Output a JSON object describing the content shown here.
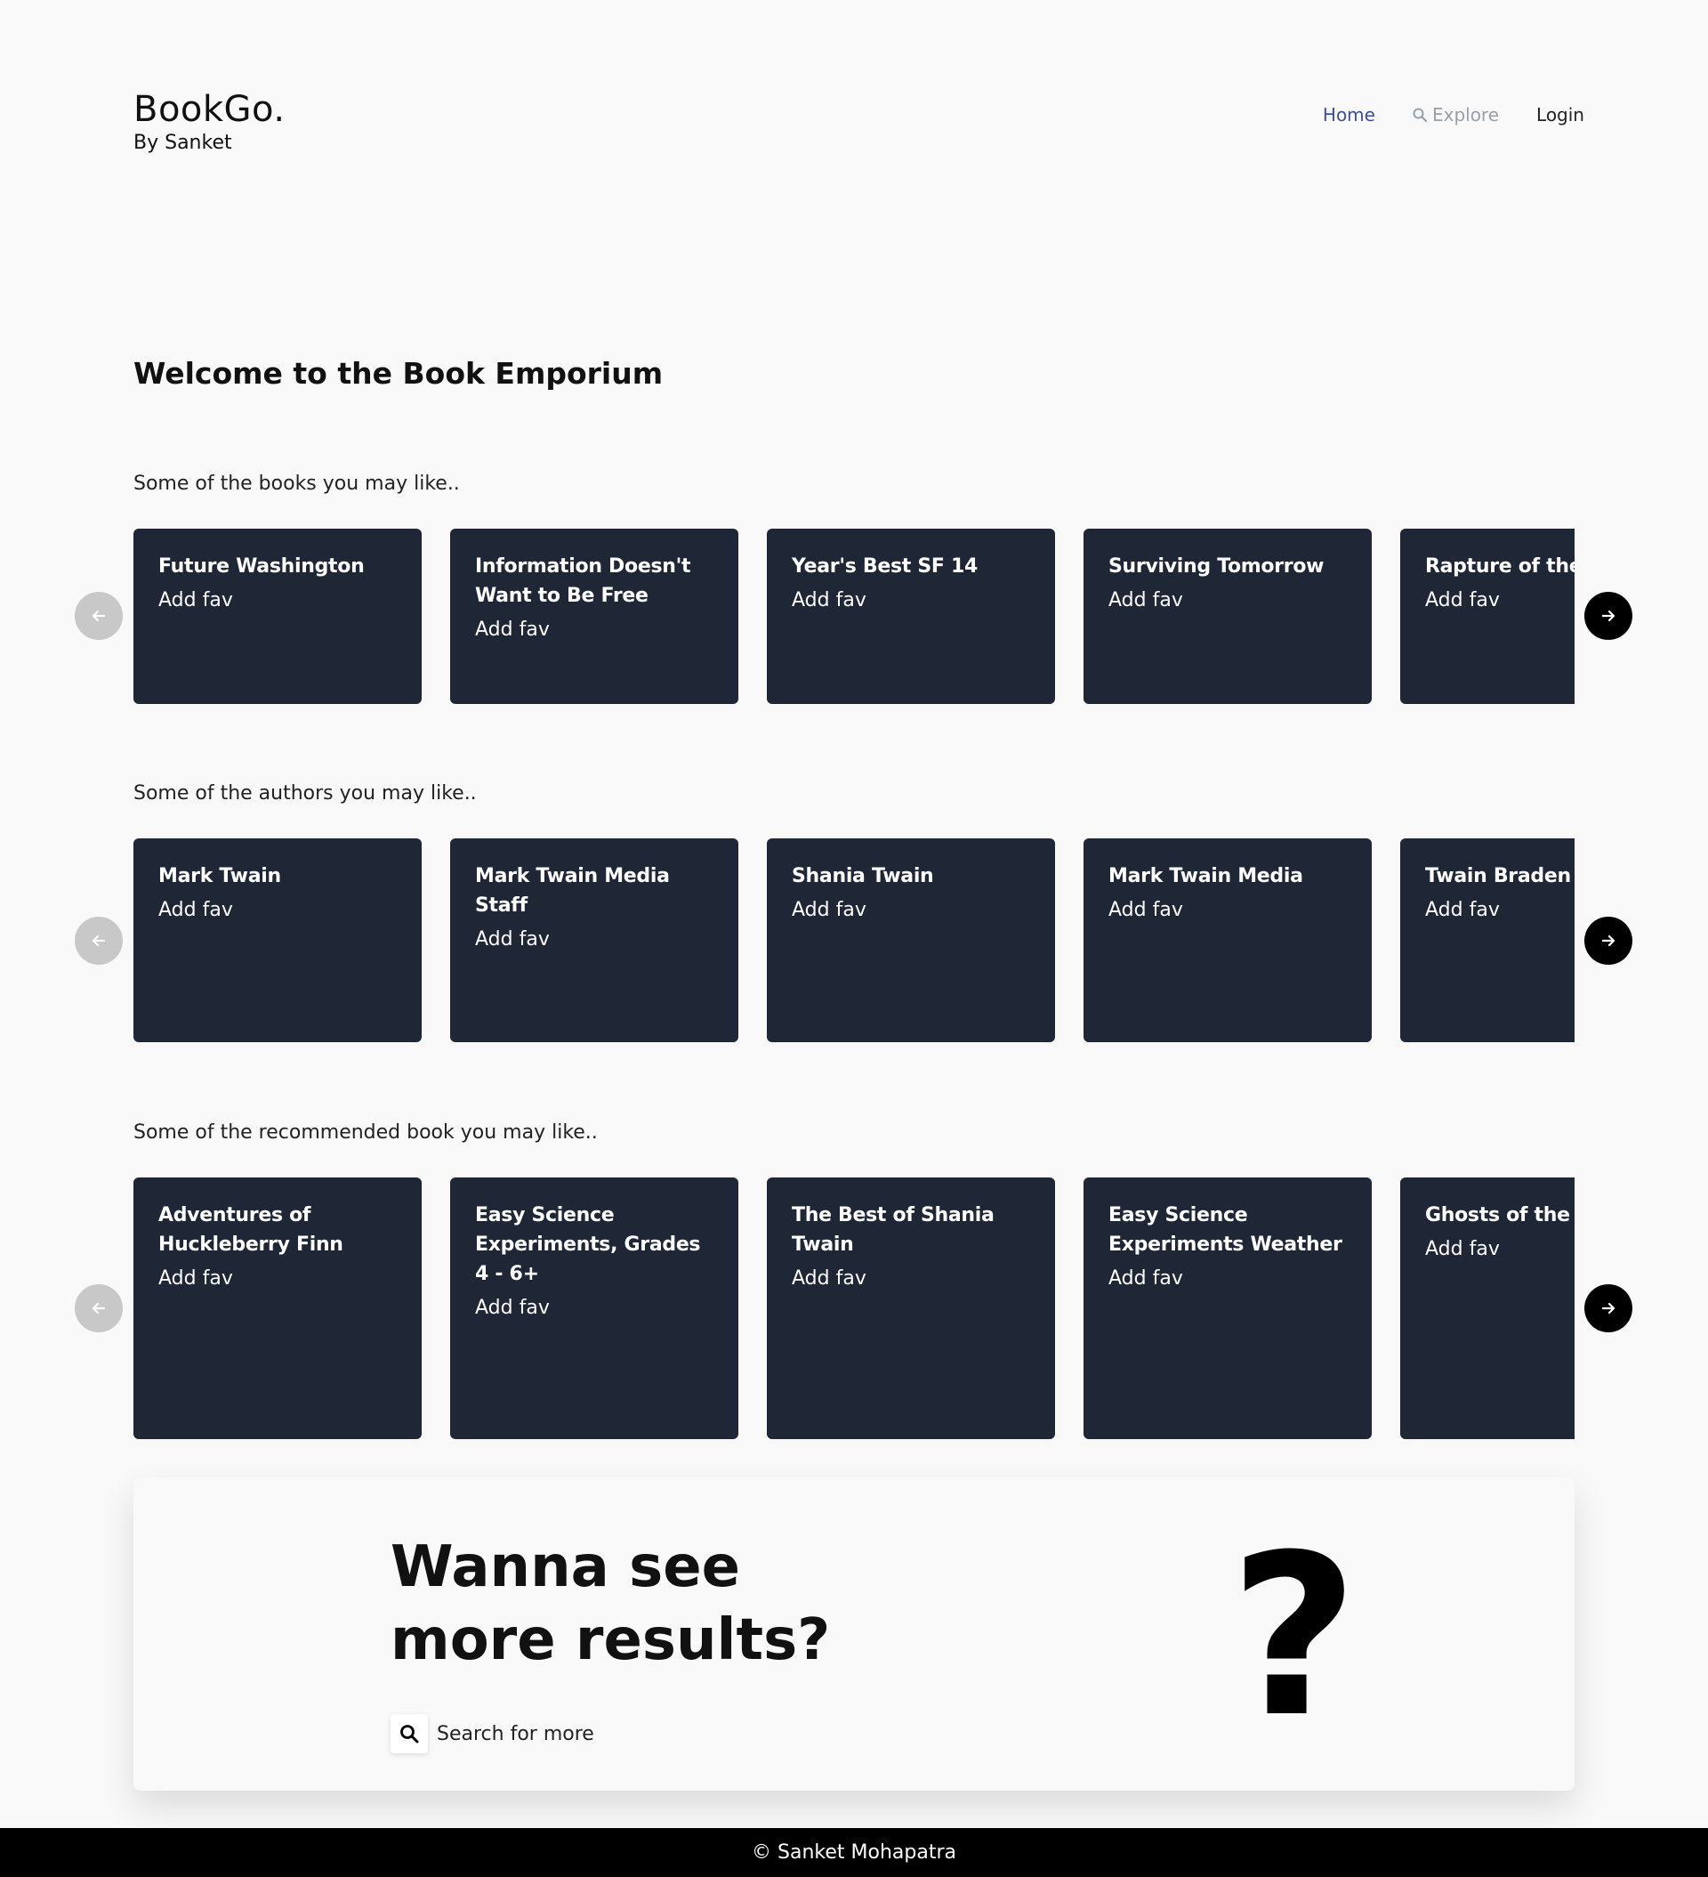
{
  "header": {
    "brand_title": "BookGo.",
    "brand_subtitle": "By Sanket",
    "nav": {
      "home": "Home",
      "explore": "Explore",
      "login": "Login"
    }
  },
  "welcome": {
    "prefix": "Welcome to the",
    "emphasis": "Book Emporium"
  },
  "sections": {
    "books": {
      "label": "Some of the books you may like..",
      "items": [
        {
          "title": "Future Washington",
          "action": "Add fav"
        },
        {
          "title": "Information Doesn't Want to Be Free",
          "action": "Add fav"
        },
        {
          "title": "Year's Best SF 14",
          "action": "Add fav"
        },
        {
          "title": "Surviving Tomorrow",
          "action": "Add fav"
        },
        {
          "title": "Rapture of the Ne",
          "action": "Add fav"
        }
      ]
    },
    "authors": {
      "label": "Some of the authors you may like..",
      "items": [
        {
          "title": "Mark Twain",
          "action": "Add fav"
        },
        {
          "title": "Mark Twain Media Staff",
          "action": "Add fav"
        },
        {
          "title": "Shania Twain",
          "action": "Add fav"
        },
        {
          "title": "Mark Twain Media",
          "action": "Add fav"
        },
        {
          "title": "Twain Braden",
          "action": "Add fav"
        }
      ]
    },
    "recommended": {
      "label": "Some of the recommended book you may like..",
      "items": [
        {
          "title": "Adventures of Huckleberry Finn",
          "action": "Add fav"
        },
        {
          "title": "Easy Science Experiments, Grades 4 - 6+",
          "action": "Add fav"
        },
        {
          "title": "The Best of Shania Twain",
          "action": "Add fav"
        },
        {
          "title": "Easy Science Experiments Weather",
          "action": "Add fav"
        },
        {
          "title": "Ghosts of the pio",
          "action": "Add fav"
        }
      ]
    }
  },
  "cta": {
    "heading": "Wanna see more results?",
    "search_label": "Search for more",
    "question_mark": "?"
  },
  "footer": {
    "text": "© Sanket Mohapatra"
  },
  "colors": {
    "card_bg": "#1f2636",
    "nav_active": "#3b4fa8",
    "nav_muted": "#9aa0a8",
    "arrow_disabled": "#c8c8c8",
    "arrow_active": "#000000"
  }
}
